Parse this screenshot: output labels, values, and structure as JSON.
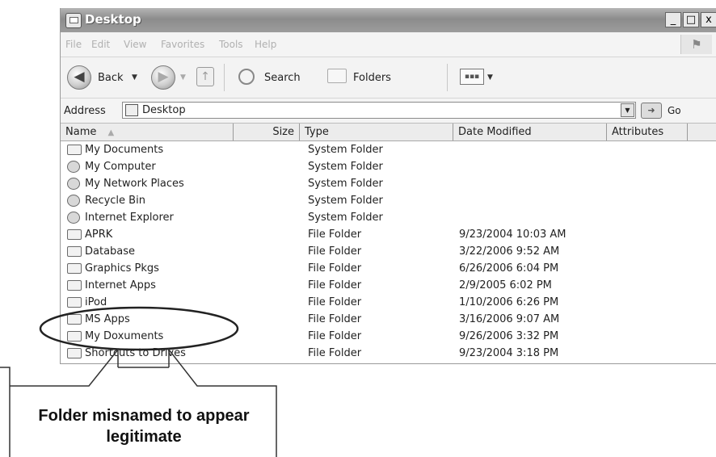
{
  "window": {
    "title": "Desktop",
    "buttons": [
      "_",
      "□",
      "x"
    ]
  },
  "menu": [
    "File",
    "Edit",
    "View",
    "Favorites",
    "Tools",
    "Help"
  ],
  "toolbar": {
    "back_label": "Back",
    "search_label": "Search",
    "folders_label": "Folders",
    "back_icon": "back-arrow-icon",
    "forward_icon": "forward-arrow-icon"
  },
  "address": {
    "label": "Address",
    "value": "Desktop",
    "go_label": "Go"
  },
  "columns": [
    "Name",
    "Size",
    "Type",
    "Date Modified",
    "Attributes"
  ],
  "files": [
    {
      "name": "My Documents",
      "type": "System Folder",
      "date": "",
      "icon": "system"
    },
    {
      "name": "My Computer",
      "type": "System Folder",
      "date": "",
      "icon": "system"
    },
    {
      "name": "My Network Places",
      "type": "System Folder",
      "date": "",
      "icon": "system"
    },
    {
      "name": "Recycle Bin",
      "type": "System Folder",
      "date": "",
      "icon": "system"
    },
    {
      "name": "Internet Explorer",
      "type": "System Folder",
      "date": "",
      "icon": "system"
    },
    {
      "name": "APRK",
      "type": "File Folder",
      "date": "9/23/2004 10:03 AM",
      "icon": "folder"
    },
    {
      "name": "Database",
      "type": "File Folder",
      "date": "3/22/2006 9:52 AM",
      "icon": "folder"
    },
    {
      "name": "Graphics Pkgs",
      "type": "File Folder",
      "date": "6/26/2006 6:04 PM",
      "icon": "folder"
    },
    {
      "name": "Internet Apps",
      "type": "File Folder",
      "date": "2/9/2005 6:02 PM",
      "icon": "folder"
    },
    {
      "name": "iPod",
      "type": "File Folder",
      "date": "1/10/2006 6:26 PM",
      "icon": "folder"
    },
    {
      "name": "MS Apps",
      "type": "File Folder",
      "date": "3/16/2006 9:07 AM",
      "icon": "folder"
    },
    {
      "name": "My Doxuments",
      "type": "File Folder",
      "date": "9/26/2006 3:32 PM",
      "icon": "folder"
    },
    {
      "name": "Shortcuts to Drives",
      "type": "File Folder",
      "date": "9/23/2004 3:18 PM",
      "icon": "folder"
    }
  ],
  "annotation": {
    "line1": "Folder misnamed to appear",
    "line2": "legitimate"
  }
}
